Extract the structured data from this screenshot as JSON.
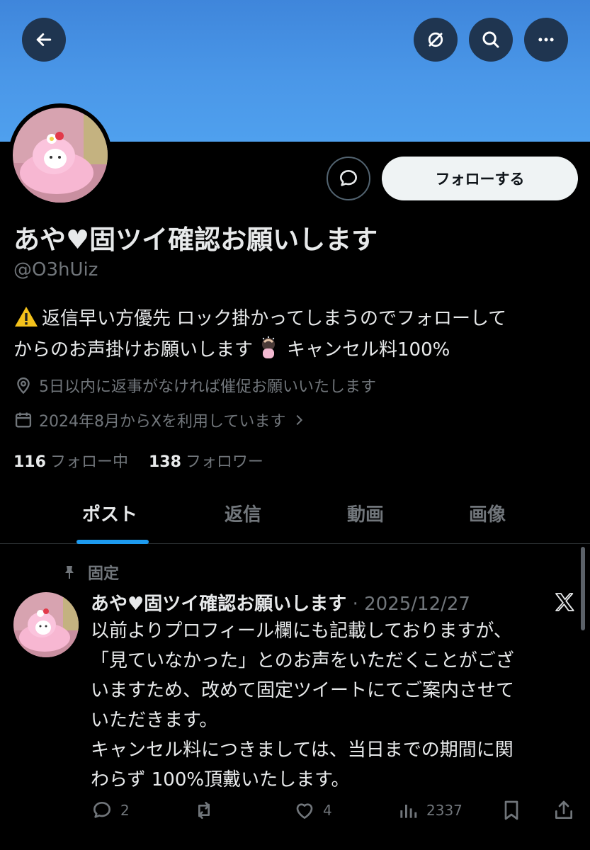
{
  "header": {
    "back_icon": "back-arrow-icon",
    "translate_icon": "translate-icon",
    "search_icon": "search-icon",
    "more_icon": "more-icon"
  },
  "profile": {
    "display_name": "あや♥固ツイ確認お願いします",
    "handle": "@O3hUiz",
    "follow_label": "フォローする",
    "bio_line1": "返信早い方優先 ロック掛かってしまうのでフォローして",
    "bio_line2a": "からのお声掛けお願いします",
    "bio_line2b": "キャンセル料100%",
    "location": "5日以内に返事がなければ催促お願いいたします",
    "joined": "2024年8月からXを利用しています",
    "following_count": "116",
    "following_label": "フォロー中",
    "followers_count": "138",
    "followers_label": "フォロワー"
  },
  "tabs": [
    {
      "label": "ポスト",
      "active": true
    },
    {
      "label": "返信",
      "active": false
    },
    {
      "label": "動画",
      "active": false
    },
    {
      "label": "画像",
      "active": false
    }
  ],
  "post": {
    "pinned_label": "固定",
    "author": "あや♥固ツイ確認お願いします",
    "separator": " · ",
    "date": "2025/12/27",
    "body_lines": [
      "以前よりプロフィール欄にも記載しておりますが、",
      "「見ていなかった」とのお声をいただくことがござ",
      "いますため、改めて固定ツイートにてご案内させて",
      "いただきます。",
      "キャンセル料につきましては、当日までの期間に関",
      "わらず 100%頂戴いたします。"
    ],
    "replies": "2",
    "reposts": "",
    "likes": "4",
    "views": "2337"
  },
  "colors": {
    "accent": "#1d9bf0",
    "banner": "#4a97e8",
    "muted": "#71767b",
    "text": "#e7e9ea"
  }
}
